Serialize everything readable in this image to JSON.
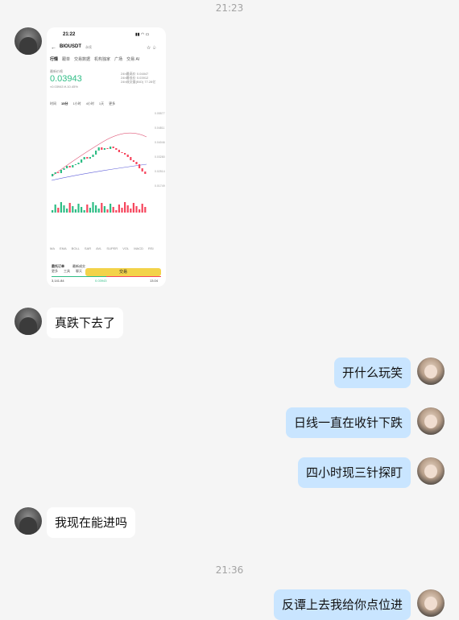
{
  "timestamps": [
    "21:23",
    "21:36"
  ],
  "screenshot": {
    "status_time": "21:22",
    "pair": "BIOUSDT",
    "pair_sub": "永续",
    "tabs": [
      "行情",
      "跟单",
      "交易数据",
      "机构独家",
      "广场",
      "交易 AI"
    ],
    "mark_label": "最新价格",
    "price": "0.03943",
    "price_change": "≈0.03943 ¥-10.45%",
    "stats": [
      "24h最高价",
      "0.04847",
      "24h最低价",
      "0.03912",
      "24h成交量(BIO)",
      "77.28亿"
    ],
    "intervals": [
      "时间",
      "15分",
      "1小时",
      "4小时",
      "1天",
      "更多"
    ],
    "indicators": [
      "MA",
      "EMA",
      "BOLL",
      "SAR",
      "AVL",
      "SUPER",
      "VOL",
      "MACD",
      "RSI"
    ],
    "chart_labels": [
      "0.05577",
      "0.04811",
      "0.04046",
      "0.03280",
      "0.02514",
      "0.01749"
    ],
    "book_tabs": [
      "委托订单",
      "最新成交"
    ],
    "book_values": [
      "3,141.84",
      "0.03943",
      "13.04"
    ],
    "nav": [
      "更多",
      "工具",
      "聊天"
    ],
    "trade_button": "交易"
  },
  "messages": [
    {
      "side": "left",
      "text": "真跌下去了"
    },
    {
      "side": "right",
      "text": "开什么玩笑"
    },
    {
      "side": "right",
      "text": "日线一直在收针下跌"
    },
    {
      "side": "right",
      "text": "四小时现三针探盯"
    },
    {
      "side": "left",
      "text": "我现在能进吗"
    },
    {
      "side": "right",
      "text": "反谭上去我给你点位进"
    }
  ],
  "colors": {
    "up": "#2ebd85",
    "down": "#f6465d",
    "bubble_out": "#c9e5ff",
    "trade_button": "#f3d34a"
  }
}
